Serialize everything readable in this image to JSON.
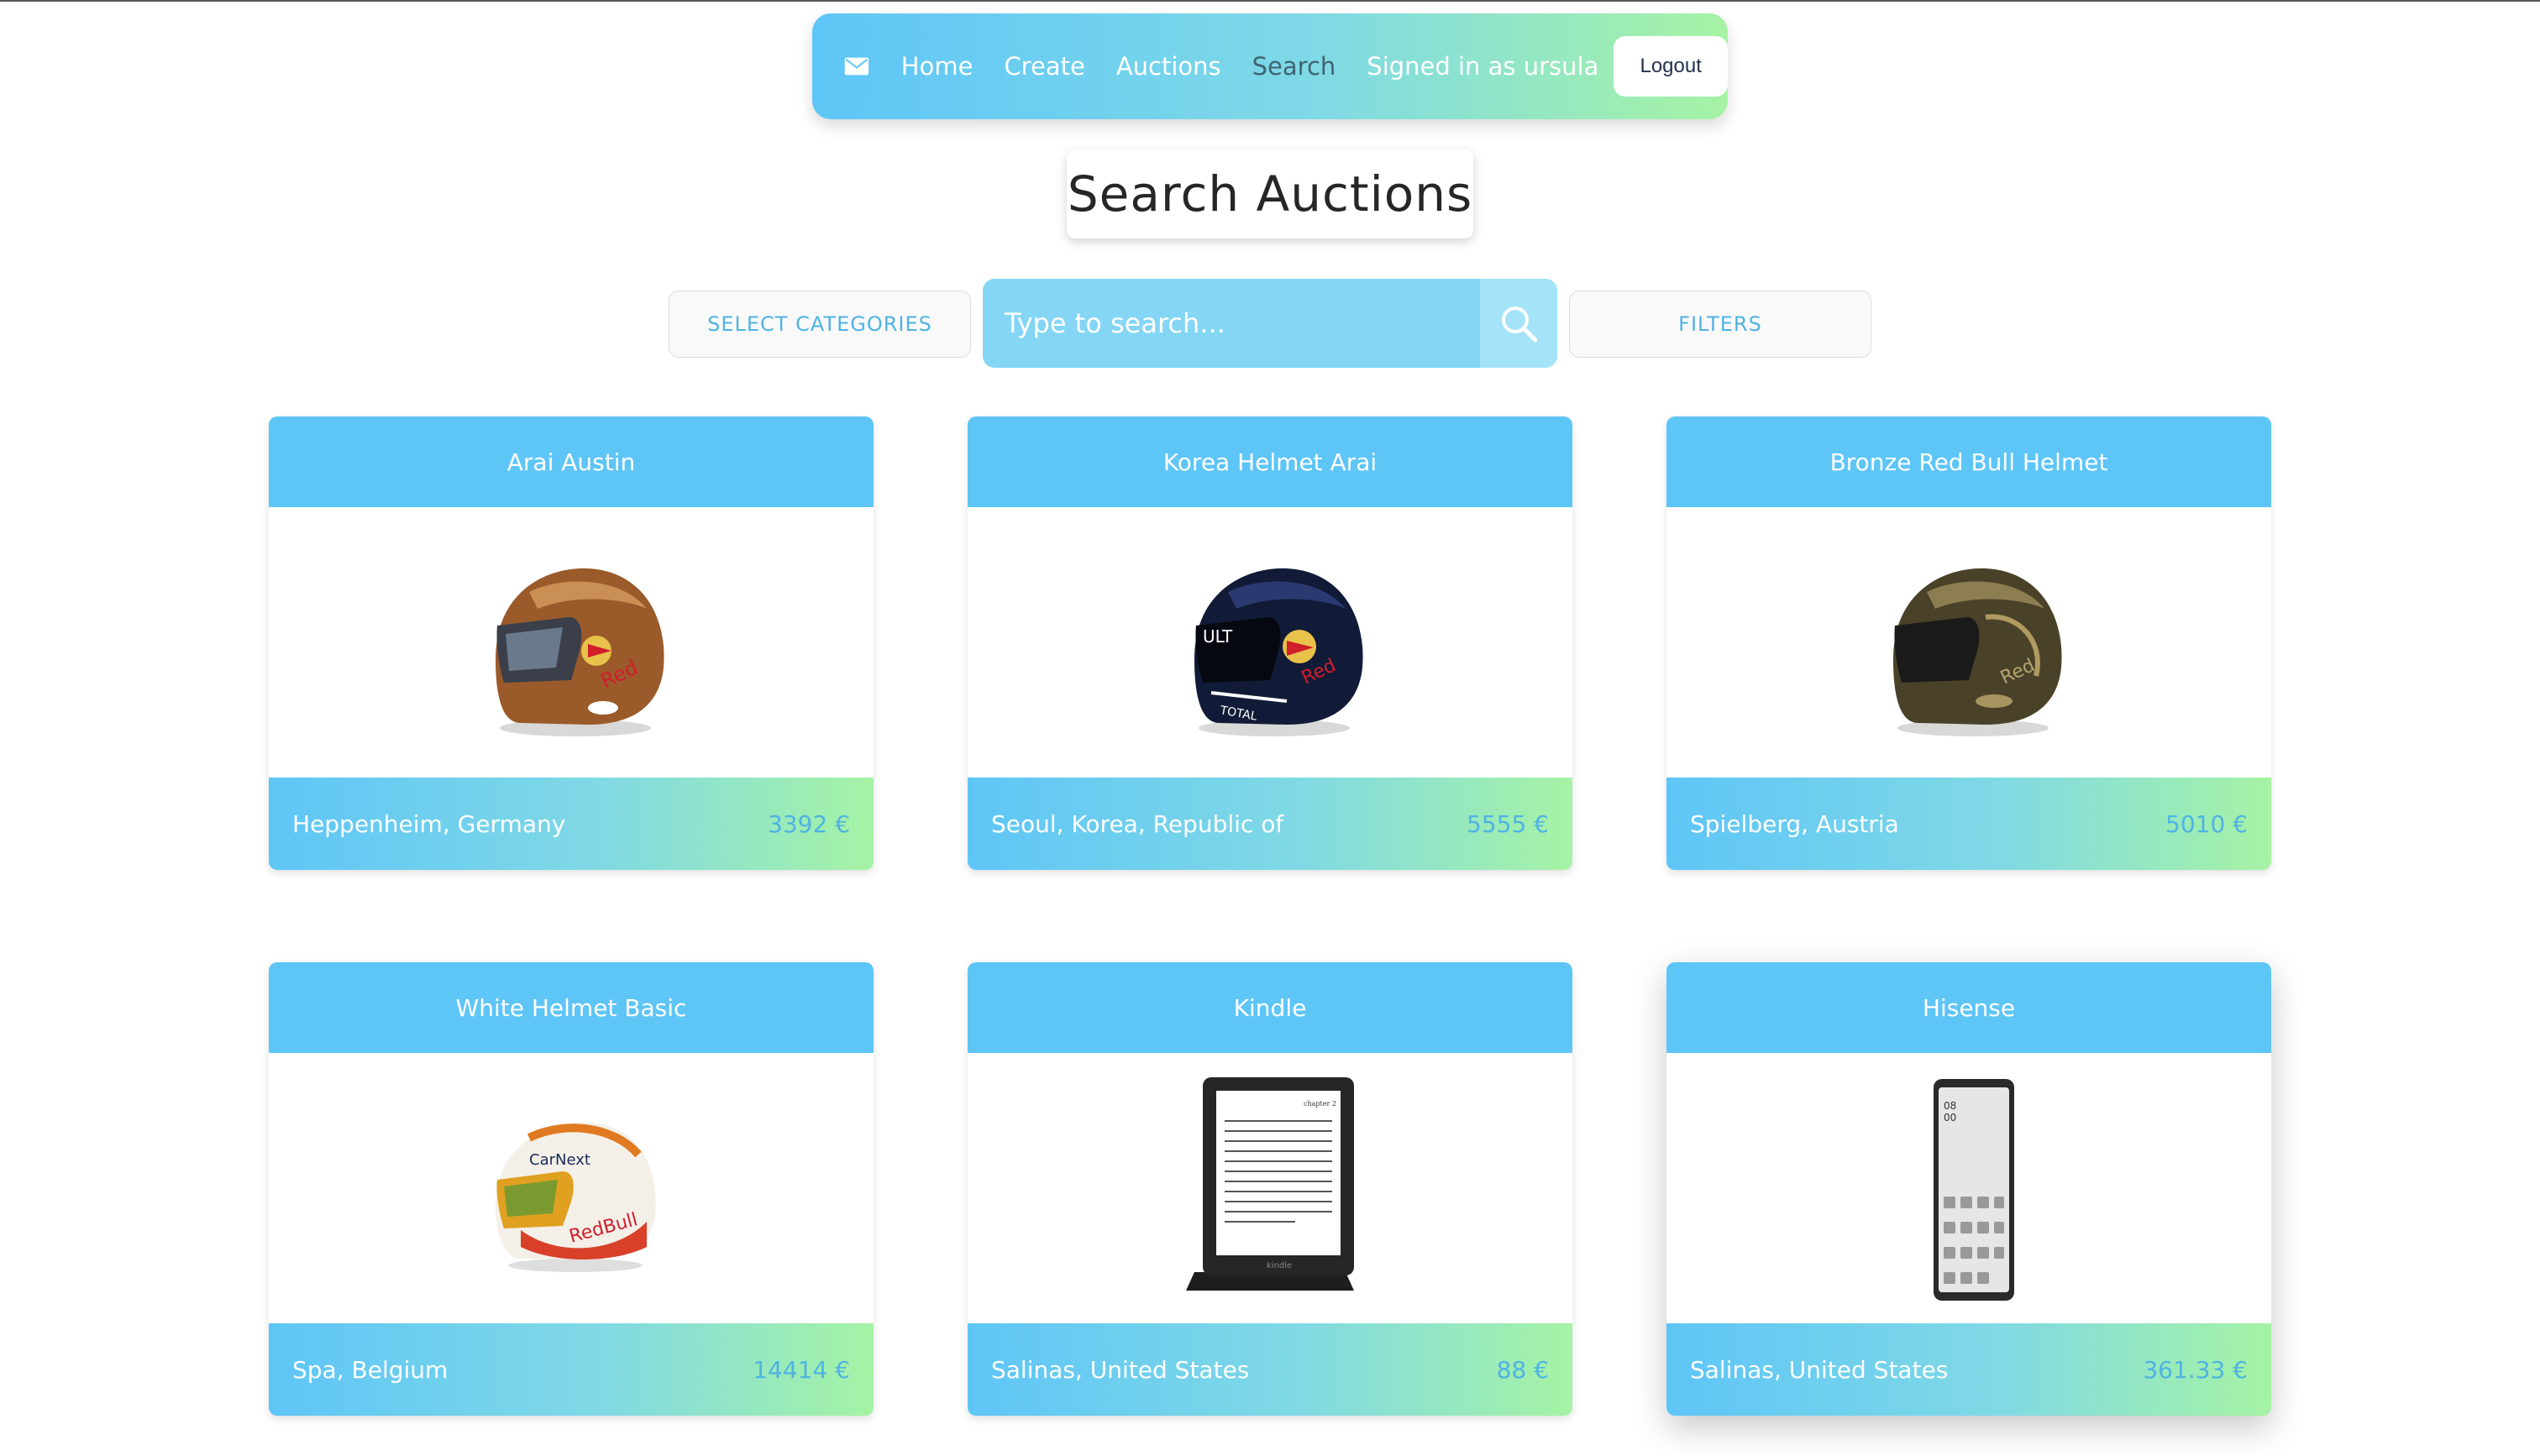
{
  "nav": {
    "mail_icon": "mail-icon",
    "links": [
      "Home",
      "Create",
      "Auctions",
      "Search"
    ],
    "active": "Search",
    "signed_in": "Signed in as ursula",
    "logout": "Logout",
    "colors": {
      "gradient_start": "#5ec5f7",
      "gradient_end": "#a6f3a4"
    }
  },
  "page": {
    "title": "Search Auctions"
  },
  "search": {
    "categories_label": "SELECT CATEGORIES",
    "placeholder": "Type to search...",
    "filters_label": "FILTERS",
    "search_icon": "search-icon"
  },
  "auctions": [
    {
      "title": "Arai Austin",
      "location": "Heppenheim, Germany",
      "price": "3392 €",
      "image": "helmet-bronze-gold"
    },
    {
      "title": "Korea Helmet Arai",
      "location": "Seoul, Korea, Republic of",
      "price": "5555 €",
      "image": "helmet-dark-blue"
    },
    {
      "title": "Bronze Red Bull Helmet",
      "location": "Spielberg, Austria",
      "price": "5010 €",
      "image": "helmet-bronze"
    },
    {
      "title": "White Helmet Basic",
      "location": "Spa, Belgium",
      "price": "14414 €",
      "image": "helmet-white-redbull"
    },
    {
      "title": "Kindle",
      "location": "Salinas, United States",
      "price": "88 €",
      "image": "ereader-on-stand"
    },
    {
      "title": "Hisense",
      "location": "Salinas, United States",
      "price": "361.33 €",
      "image": "eink-phone"
    }
  ]
}
